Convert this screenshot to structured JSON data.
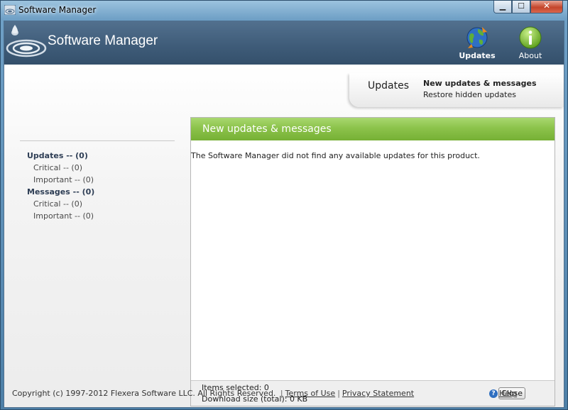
{
  "window": {
    "title": "Software Manager",
    "controls": {
      "minimize": "▁",
      "maximize": "☐",
      "close": "✕"
    }
  },
  "header": {
    "title": "Software Manager",
    "nav": [
      {
        "label": "Updates",
        "icon": "updates-globe-icon"
      },
      {
        "label": "About",
        "icon": "info-icon"
      }
    ]
  },
  "tabs": {
    "title": "Updates",
    "links": [
      "New updates & messages",
      "Restore hidden updates"
    ]
  },
  "sidebar": {
    "items": [
      {
        "label": "Updates -- (0)",
        "level": 0
      },
      {
        "label": "Critical -- (0)",
        "level": 1
      },
      {
        "label": "Important -- (0)",
        "level": 1
      },
      {
        "label": "Messages -- (0)",
        "level": 0
      },
      {
        "label": "Critical -- (0)",
        "level": 1
      },
      {
        "label": "Important -- (0)",
        "level": 1
      }
    ]
  },
  "panel": {
    "title": "New updates & messages",
    "message": "The Software Manager did not find any available updates for this product.",
    "items_selected": "Items selected: 0",
    "download_size": "Download size (total): 0 KB",
    "close_label": "Close"
  },
  "footer": {
    "copyright": "Copyright (c) 1997-2012 Flexera Software LLC. All Rights Reserved.",
    "separator": "|",
    "terms": "Terms of Use",
    "privacy": "Privacy Statement",
    "help": "Help",
    "help_glyph": "?"
  },
  "colors": {
    "header_bg": "#3e5b78",
    "panel_header_green": "#8cc34b",
    "accent_text": "#2e3e55"
  }
}
